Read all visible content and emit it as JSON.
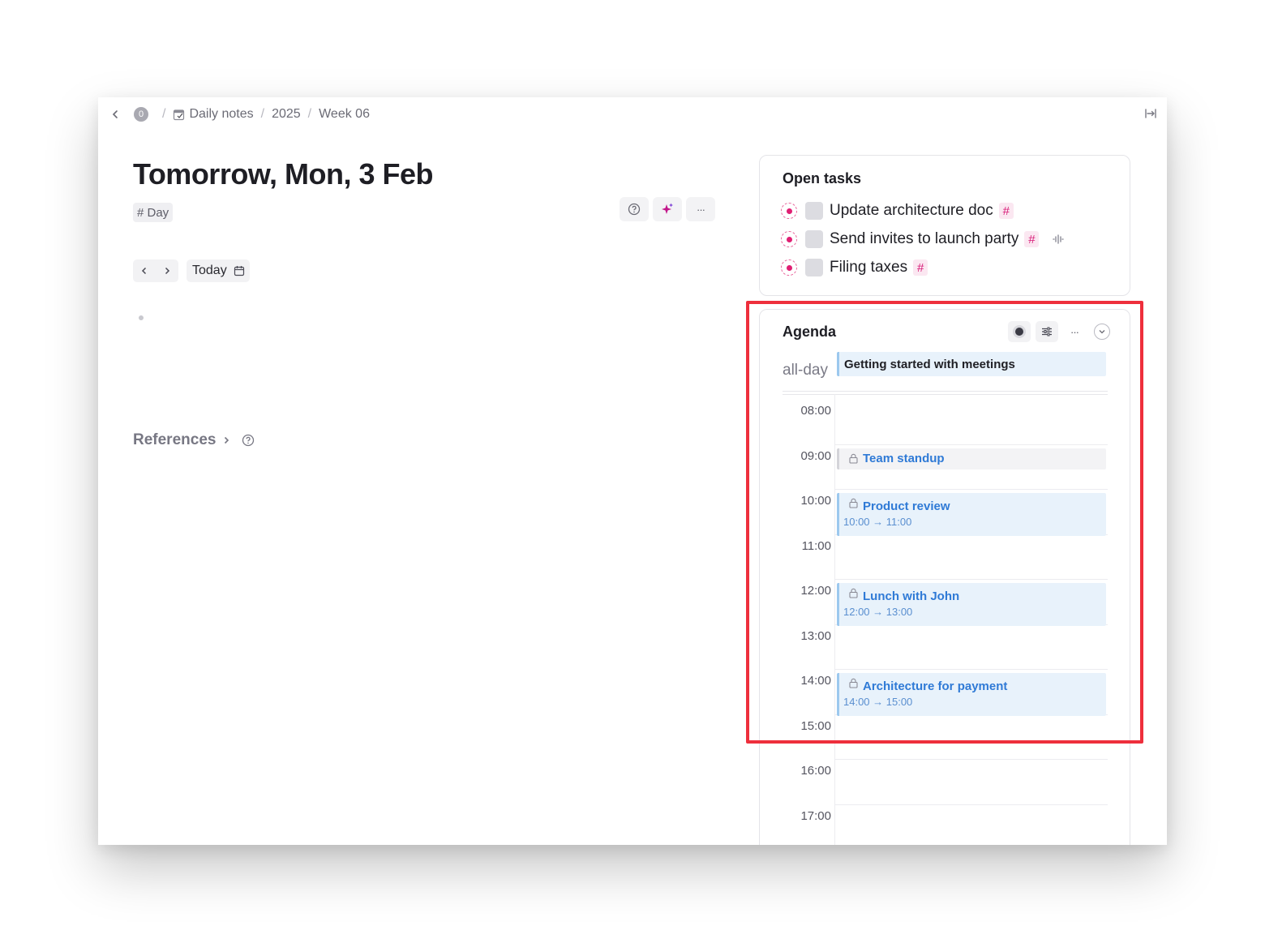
{
  "breadcrumb": {
    "badge": "0",
    "items": [
      "Daily notes",
      "2025",
      "Week 06"
    ]
  },
  "page": {
    "title": "Tomorrow, Mon, 3 Feb",
    "tag": "# Day"
  },
  "toolbar": {
    "help": "help-icon",
    "ai": "sparkle-icon",
    "more": "···"
  },
  "date_nav": {
    "today_label": "Today"
  },
  "references": {
    "label": "References"
  },
  "open_tasks": {
    "title": "Open tasks",
    "items": [
      {
        "label": "Update architecture doc",
        "hash": "#"
      },
      {
        "label": "Send invites to launch party",
        "hash": "#"
      },
      {
        "label": "Filing taxes",
        "hash": "#"
      }
    ]
  },
  "agenda": {
    "title": "Agenda",
    "more": "···",
    "allday_label": "all-day",
    "allday_event": "Getting started with meetings",
    "hours": [
      "08:00",
      "09:00",
      "10:00",
      "11:00",
      "12:00",
      "13:00",
      "14:00",
      "15:00",
      "16:00",
      "17:00"
    ],
    "events": [
      {
        "name": "Team standup",
        "time": ""
      },
      {
        "name": "Product review",
        "time": "10:00 → 11:00"
      },
      {
        "name": "Lunch with John",
        "time": "12:00 → 13:00"
      },
      {
        "name": "Architecture for payment",
        "time": "14:00 → 15:00"
      }
    ]
  },
  "colors": {
    "accent_pink": "#e01f73",
    "event_blue": "#2f7ad6",
    "event_bg": "#e8f2fb",
    "highlight_red": "#ee2f3c"
  }
}
